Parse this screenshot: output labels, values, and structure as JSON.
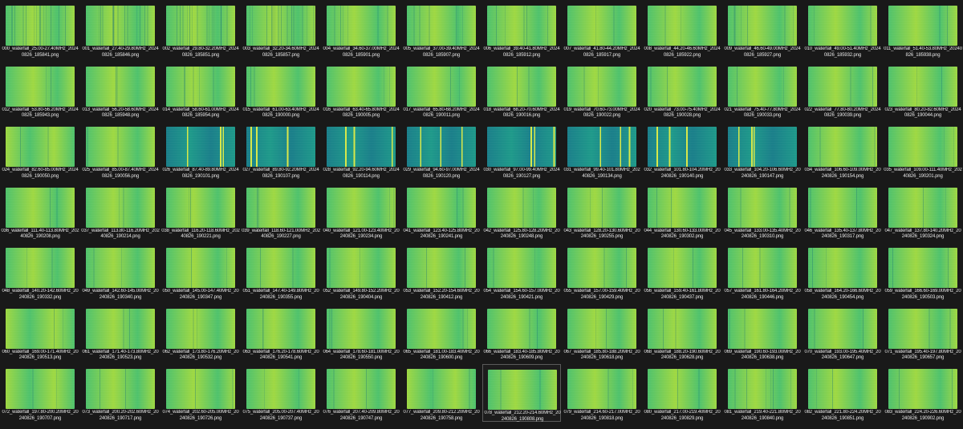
{
  "explorer": {
    "view": "large-icons",
    "thumbnail_colors": {
      "yellow_green": "#9fd843",
      "green": "#4fc26d",
      "teal": "#1f9a8a",
      "dark_teal": "#1b7f8a",
      "signal_yellow": "#d8e84a"
    },
    "selected_index": 78,
    "files": [
      {
        "name": "000_waterfall_25.00-27.40MHz_20240826_185841.png",
        "theme": "green",
        "signals": "dense"
      },
      {
        "name": "001_waterfall_27.40-29.80MHz_20240826_185846.png",
        "theme": "green",
        "signals": "dense"
      },
      {
        "name": "002_waterfall_29.80-32.20MHz_20240826_185851.png",
        "theme": "green",
        "signals": "dense"
      },
      {
        "name": "003_waterfall_32.20-34.60MHz_20240826_185857.png",
        "theme": "green",
        "signals": "dense"
      },
      {
        "name": "004_waterfall_34.60-37.00MHz_20240826_185901.png",
        "theme": "green",
        "signals": "medium"
      },
      {
        "name": "005_waterfall_37.00-39.40MHz_20240826_185907.png",
        "theme": "green",
        "signals": "medium"
      },
      {
        "name": "006_waterfall_39.40-41.80MHz_20240826_185912.png",
        "theme": "green",
        "signals": "medium"
      },
      {
        "name": "007_waterfall_41.80-44.20MHz_20240826_185917.png",
        "theme": "green",
        "signals": "light"
      },
      {
        "name": "008_waterfall_44.20-46.60MHz_20240826_185922.png",
        "theme": "green",
        "signals": "light"
      },
      {
        "name": "009_waterfall_46.60-49.00MHz_20240826_185927.png",
        "theme": "green",
        "signals": "medium"
      },
      {
        "name": "010_waterfall_49.00-51.40MHz_20240826_185932.png",
        "theme": "green",
        "signals": "light"
      },
      {
        "name": "011_waterfall_51.40-53.80MHz_20240826_185938.png",
        "theme": "green",
        "signals": "light"
      },
      {
        "name": "012_waterfall_53.80-56.20MHz_20240826_185943.png",
        "theme": "green",
        "signals": "light"
      },
      {
        "name": "013_waterfall_56.20-58.60MHz_20240826_185948.png",
        "theme": "green",
        "signals": "light"
      },
      {
        "name": "014_waterfall_58.60-61.00MHz_20240826_185954.png",
        "theme": "green",
        "signals": "medium"
      },
      {
        "name": "015_waterfall_61.00-63.40MHz_20240826_190000.png",
        "theme": "green",
        "signals": "light"
      },
      {
        "name": "016_waterfall_63.40-65.80MHz_20240826_190005.png",
        "theme": "green",
        "signals": "light"
      },
      {
        "name": "017_waterfall_65.80-68.20MHz_20240826_190011.png",
        "theme": "green",
        "signals": "light"
      },
      {
        "name": "018_waterfall_68.20-70.60MHz_20240826_190016.png",
        "theme": "green",
        "signals": "light"
      },
      {
        "name": "019_waterfall_70.60-73.00MHz_20240826_190022.png",
        "theme": "green",
        "signals": "light"
      },
      {
        "name": "020_waterfall_73.00-75.40MHz_20240826_190028.png",
        "theme": "green",
        "signals": "light"
      },
      {
        "name": "021_waterfall_75.40-77.80MHz_20240826_190033.png",
        "theme": "green",
        "signals": "light"
      },
      {
        "name": "022_waterfall_77.80-80.20MHz_20240826_190039.png",
        "theme": "green",
        "signals": "light"
      },
      {
        "name": "023_waterfall_80.20-82.60MHz_20240826_190044.png",
        "theme": "green",
        "signals": "light"
      },
      {
        "name": "024_waterfall_82.60-85.00MHz_20240826_190050.png",
        "theme": "yellow",
        "signals": "light"
      },
      {
        "name": "025_waterfall_85.00-87.40MHz_20240826_190056.png",
        "theme": "green",
        "signals": "light"
      },
      {
        "name": "026_waterfall_87.40-89.80MHz_20240826_190101.png",
        "theme": "teal",
        "signals": "fm"
      },
      {
        "name": "027_waterfall_89.80-92.20MHz_20240826_190107.png",
        "theme": "teal",
        "signals": "fm"
      },
      {
        "name": "028_waterfall_92.20-94.60MHz_20240826_190114.png",
        "theme": "teal",
        "signals": "fm"
      },
      {
        "name": "029_waterfall_94.60-97.00MHz_20240826_190120.png",
        "theme": "teal",
        "signals": "fm"
      },
      {
        "name": "030_waterfall_97.00-99.40MHz_20240826_190127.png",
        "theme": "teal",
        "signals": "fm"
      },
      {
        "name": "031_waterfall_99.40-101.80MHz_20240826_190134.png",
        "theme": "teal",
        "signals": "fm"
      },
      {
        "name": "032_waterfall_101.80-104.20MHz_20240826_190140.png",
        "theme": "teal",
        "signals": "fm"
      },
      {
        "name": "033_waterfall_104.20-106.60MHz_20240826_190147.png",
        "theme": "teal",
        "signals": "fm"
      },
      {
        "name": "034_waterfall_106.60-109.00MHz_20240826_190154.png",
        "theme": "green",
        "signals": "light"
      },
      {
        "name": "035_waterfall_109.00-111.40MHz_20240826_190201.png",
        "theme": "green",
        "signals": "light"
      },
      {
        "name": "036_waterfall_111.40-113.80MHz_20240826_190208.png",
        "theme": "green",
        "signals": "light"
      },
      {
        "name": "037_waterfall_113.80-116.20MHz_20240826_190214.png",
        "theme": "green",
        "signals": "light"
      },
      {
        "name": "038_waterfall_116.20-118.60MHz_20240826_190221.png",
        "theme": "green",
        "signals": "light"
      },
      {
        "name": "039_waterfall_118.60-121.00MHz_20240826_190227.png",
        "theme": "green",
        "signals": "light"
      },
      {
        "name": "040_waterfall_121.00-123.40MHz_20240826_190234.png",
        "theme": "green",
        "signals": "light"
      },
      {
        "name": "041_waterfall_123.40-125.80MHz_20240826_190241.png",
        "theme": "green",
        "signals": "light"
      },
      {
        "name": "042_waterfall_125.80-128.20MHz_20240826_190248.png",
        "theme": "green",
        "signals": "light"
      },
      {
        "name": "043_waterfall_128.20-130.60MHz_20240826_190255.png",
        "theme": "green",
        "signals": "light"
      },
      {
        "name": "044_waterfall_130.60-133.00MHz_20240826_190302.png",
        "theme": "green",
        "signals": "light"
      },
      {
        "name": "045_waterfall_133.00-135.40MHz_20240826_190310.png",
        "theme": "green",
        "signals": "light"
      },
      {
        "name": "046_waterfall_135.40-137.80MHz_20240826_190317.png",
        "theme": "green",
        "signals": "light"
      },
      {
        "name": "047_waterfall_137.80-140.20MHz_20240826_190324.png",
        "theme": "green",
        "signals": "light"
      },
      {
        "name": "048_waterfall_140.20-142.60MHz_20240826_190332.png",
        "theme": "green",
        "signals": "light"
      },
      {
        "name": "049_waterfall_142.60-145.00MHz_20240826_190340.png",
        "theme": "green",
        "signals": "light"
      },
      {
        "name": "050_waterfall_145.00-147.40MHz_20240826_190347.png",
        "theme": "green",
        "signals": "light"
      },
      {
        "name": "051_waterfall_147.40-149.80MHz_20240826_190355.png",
        "theme": "green",
        "signals": "light"
      },
      {
        "name": "052_waterfall_149.80-152.20MHz_20240826_190404.png",
        "theme": "green",
        "signals": "light"
      },
      {
        "name": "053_waterfall_152.20-154.60MHz_20240826_190412.png",
        "theme": "green",
        "signals": "light"
      },
      {
        "name": "054_waterfall_154.60-157.00MHz_20240826_190421.png",
        "theme": "green",
        "signals": "light"
      },
      {
        "name": "055_waterfall_157.00-159.40MHz_20240826_190429.png",
        "theme": "green",
        "signals": "light"
      },
      {
        "name": "056_waterfall_159.40-161.80MHz_20240826_190437.png",
        "theme": "green",
        "signals": "light"
      },
      {
        "name": "057_waterfall_161.80-164.20MHz_20240826_190446.png",
        "theme": "green",
        "signals": "light"
      },
      {
        "name": "058_waterfall_164.20-166.60MHz_20240826_190454.png",
        "theme": "green",
        "signals": "light"
      },
      {
        "name": "059_waterfall_166.60-169.00MHz_20240826_190503.png",
        "theme": "green",
        "signals": "light"
      },
      {
        "name": "060_waterfall_169.00-171.40MHz_20240826_190513.png",
        "theme": "yellow",
        "signals": "light"
      },
      {
        "name": "061_waterfall_171.40-173.80MHz_20240826_190523.png",
        "theme": "green",
        "signals": "light"
      },
      {
        "name": "062_waterfall_173.80-176.20MHz_20240826_190532.png",
        "theme": "green",
        "signals": "light"
      },
      {
        "name": "063_waterfall_176.20-178.60MHz_20240826_190541.png",
        "theme": "green",
        "signals": "light"
      },
      {
        "name": "064_waterfall_178.60-181.00MHz_20240826_190550.png",
        "theme": "green",
        "signals": "light"
      },
      {
        "name": "065_waterfall_181.00-183.40MHz_20240826_190600.png",
        "theme": "green",
        "signals": "light"
      },
      {
        "name": "066_waterfall_183.40-185.80MHz_20240826_190609.png",
        "theme": "green",
        "signals": "light"
      },
      {
        "name": "067_waterfall_185.80-188.20MHz_20240826_190618.png",
        "theme": "green",
        "signals": "light"
      },
      {
        "name": "068_waterfall_188.20-190.60MHz_20240826_190628.png",
        "theme": "green",
        "signals": "light"
      },
      {
        "name": "069_waterfall_190.60-193.00MHz_20240826_190638.png",
        "theme": "green",
        "signals": "light"
      },
      {
        "name": "070_waterfall_193.00-195.40MHz_20240826_190647.png",
        "theme": "green",
        "signals": "light"
      },
      {
        "name": "071_waterfall_195.40-197.80MHz_20240826_190657.png",
        "theme": "green",
        "signals": "light"
      },
      {
        "name": "072_waterfall_197.80-200.20MHz_20240826_190707.png",
        "theme": "yellow",
        "signals": "light"
      },
      {
        "name": "073_waterfall_200.20-202.60MHz_20240826_190717.png",
        "theme": "green",
        "signals": "light"
      },
      {
        "name": "074_waterfall_202.60-205.00MHz_20240826_190726.png",
        "theme": "green",
        "signals": "light"
      },
      {
        "name": "075_waterfall_205.00-207.40MHz_20240826_190737.png",
        "theme": "green",
        "signals": "light"
      },
      {
        "name": "076_waterfall_207.40-209.80MHz_20240826_190747.png",
        "theme": "green",
        "signals": "light"
      },
      {
        "name": "077_waterfall_209.80-212.20MHz_20240826_190758.png",
        "theme": "yellow",
        "signals": "light"
      },
      {
        "name": "078_waterfall_212.20-214.60MHz_20240826_190808.png",
        "theme": "green",
        "signals": "light"
      },
      {
        "name": "079_waterfall_214.60-217.00MHz_20240826_190818.png",
        "theme": "green",
        "signals": "light"
      },
      {
        "name": "080_waterfall_217.00-219.40MHz_20240826_190829.png",
        "theme": "green",
        "signals": "light"
      },
      {
        "name": "081_waterfall_219.40-221.80MHz_20240826_190840.png",
        "theme": "green",
        "signals": "medium"
      },
      {
        "name": "082_waterfall_221.80-224.20MHz_20240826_190851.png",
        "theme": "green",
        "signals": "light"
      },
      {
        "name": "083_waterfall_224.20-226.60MHz_20240826_190902.png",
        "theme": "green",
        "signals": "light"
      }
    ]
  }
}
